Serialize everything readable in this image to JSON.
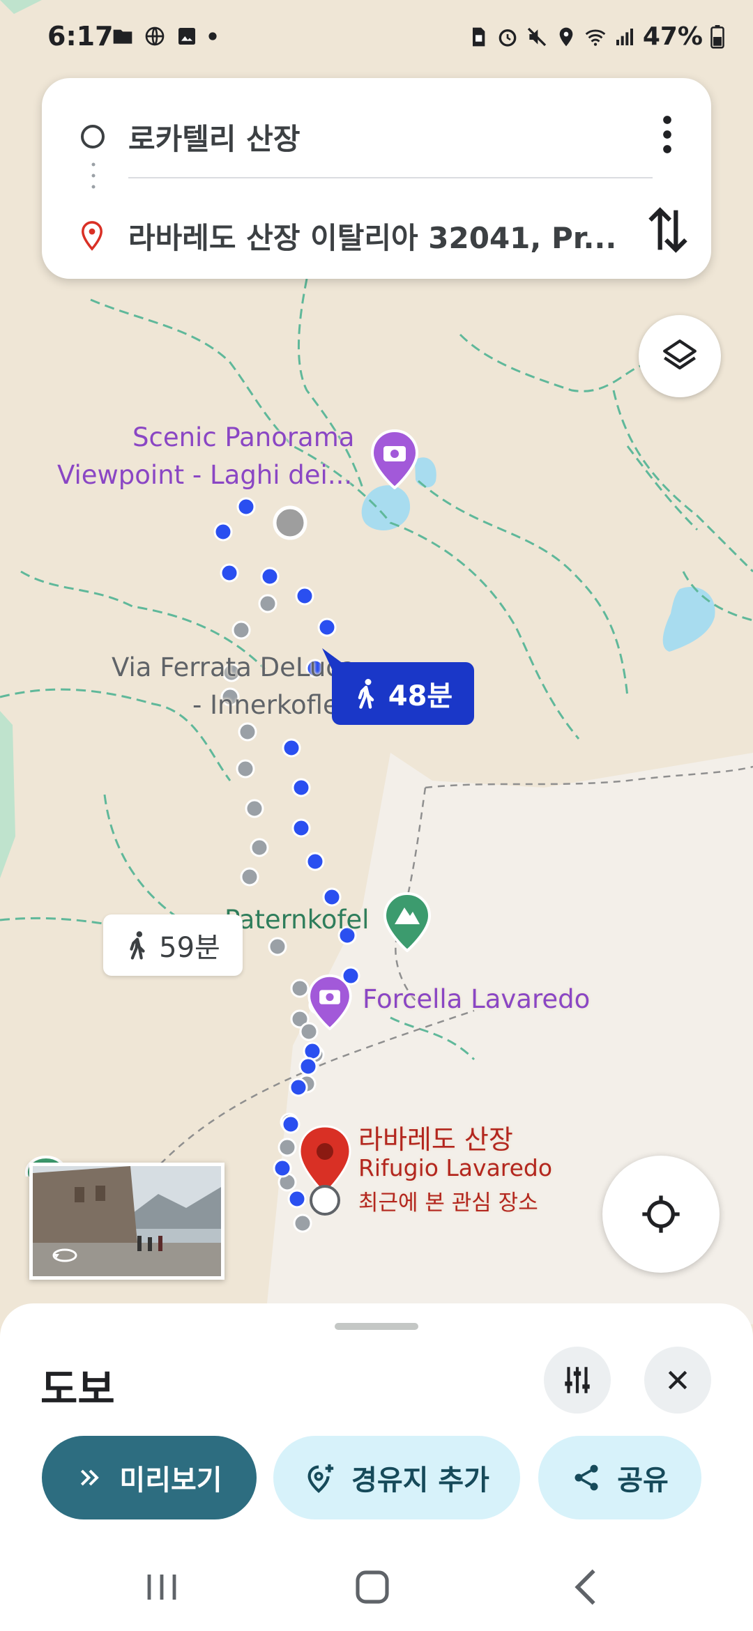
{
  "status_bar": {
    "time": "6:17",
    "battery": "47%",
    "left_icons": [
      "folder-icon",
      "globe-icon",
      "image-icon",
      "dot-icon"
    ],
    "right_icons": [
      "sim-icon",
      "alarm-icon",
      "mute-icon",
      "location-icon",
      "wifi-icon",
      "signal-icon",
      "battery-icon"
    ]
  },
  "search": {
    "origin": "로카텔리 산장",
    "destination": "라바레도 산장 이탈리아 32041, Pr..."
  },
  "map": {
    "poi": {
      "scenic_line1": "Scenic Panorama",
      "scenic_line2": "Viewpoint -  Laghi dei...",
      "ferrata_line1": "Via Ferrata DeLuca",
      "ferrata_line2": "- Innerkofler",
      "paternkofel": "Paternkofel",
      "forcella": "Forcella Lavaredo",
      "dest_ko": "라바레도 산장",
      "dest_it": "Rifugio Lavaredo",
      "dest_recent": "최근에 본 관심 장소"
    },
    "route_primary_time": "48분",
    "route_alt_time": "59분",
    "colors": {
      "route_primary": "#2a4ff0",
      "route_alt": "#9aa0a6",
      "trail": "#5fb89a",
      "water": "#a8dcef",
      "land": "#efe6d6",
      "rock": "#f3efe9",
      "destination_pin": "#d93025"
    }
  },
  "sheet": {
    "mode": "도보",
    "preview_label": "미리보기",
    "add_waypoint_label": "경유지 추가",
    "share_label": "공유"
  }
}
